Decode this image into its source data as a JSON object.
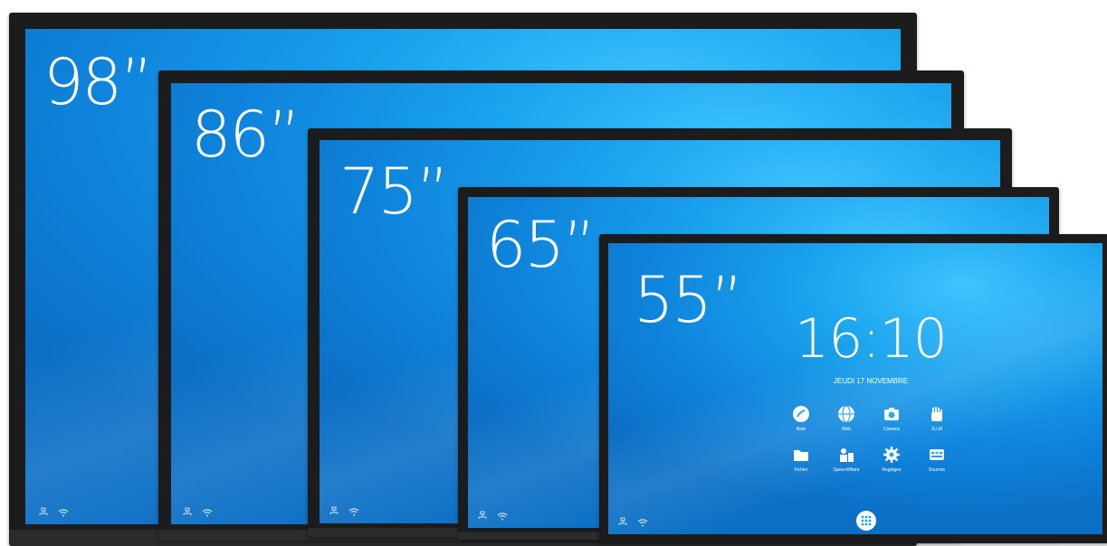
{
  "displays": [
    {
      "size": "98”"
    },
    {
      "size": "86”"
    },
    {
      "size": "75”"
    },
    {
      "size": "65”"
    },
    {
      "size": "55”"
    }
  ],
  "home": {
    "time": "16:10",
    "date": "JEUDI 17 NOVEMBRE",
    "apps": [
      {
        "label": "Note",
        "icon": "note-icon"
      },
      {
        "label": "Web",
        "icon": "globe-icon"
      },
      {
        "label": "Camera",
        "icon": "camera-icon"
      },
      {
        "label": "JLLM",
        "icon": "hand-icon"
      },
      {
        "label": "Fichier",
        "icon": "folder-icon"
      },
      {
        "label": "Speechliftare",
        "icon": "people-icon"
      },
      {
        "label": "Reglages",
        "icon": "gear-icon"
      },
      {
        "label": "Sources",
        "icon": "sources-icon"
      }
    ],
    "launcher_icon": "apps-grid-icon"
  },
  "colors": {
    "bezel": "#1c1c1c",
    "screen": "#1aa3ee",
    "text": "#ffffff"
  }
}
